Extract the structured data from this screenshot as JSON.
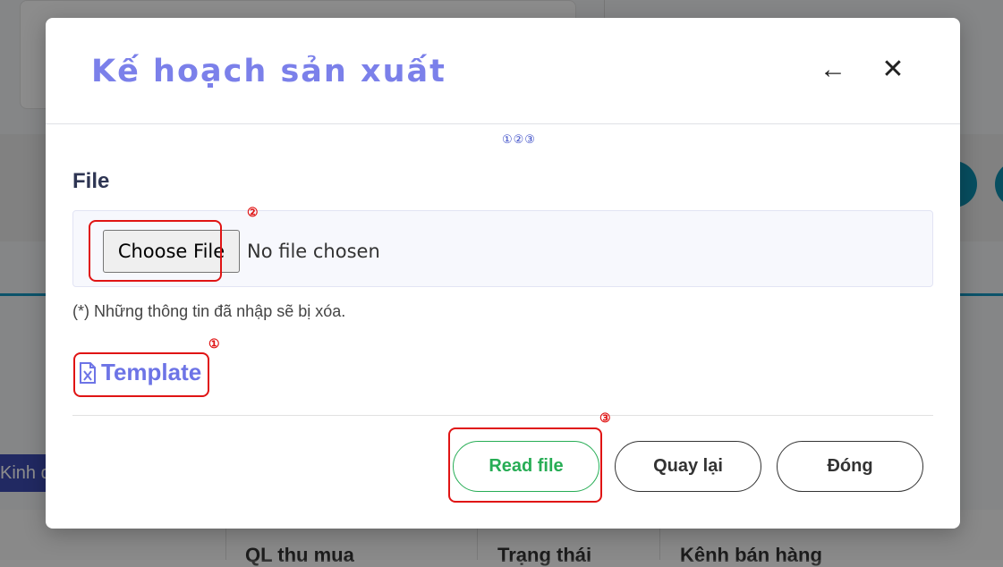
{
  "modal": {
    "title": "Kế hoạch sản xuất",
    "back_icon": "←",
    "close_icon": "✕",
    "callout_legend": "①②③",
    "file_label": "File",
    "choose_file_label": "Choose File",
    "no_file_text": "No file chosen",
    "note": "(*) Những thông tin đã nhập sẽ bị xóa.",
    "template_label": "Template",
    "template_icon": "excel-file-icon",
    "buttons": {
      "read_file": "Read file",
      "back": "Quay lại",
      "close": "Đóng"
    }
  },
  "callouts": {
    "one": "①",
    "two": "②",
    "three": "③"
  },
  "background": {
    "chip_text": "Kinh d",
    "table_headers": [
      "QL thu mua",
      "Trạng thái",
      "Kênh bán hàng"
    ]
  },
  "colors": {
    "title": "#7b80ea",
    "template_link": "#6d74e6",
    "read_file": "#27ad55",
    "callout": "#e01414"
  }
}
